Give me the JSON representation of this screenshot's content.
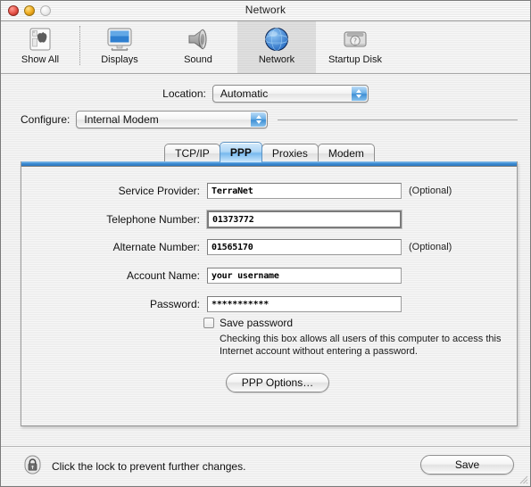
{
  "window": {
    "title": "Network",
    "controls": [
      {
        "name": "close-button",
        "color": "#e8564c"
      },
      {
        "name": "minimize-button",
        "color": "#f0ad20"
      },
      {
        "name": "zoom-button",
        "color": "#ececec"
      }
    ]
  },
  "toolbar": {
    "items": [
      {
        "label": "Show All",
        "icon": "show-all-icon",
        "selected": false
      },
      {
        "label": "Displays",
        "icon": "displays-icon",
        "selected": false
      },
      {
        "label": "Sound",
        "icon": "sound-icon",
        "selected": false
      },
      {
        "label": "Network",
        "icon": "network-icon",
        "selected": true
      },
      {
        "label": "Startup Disk",
        "icon": "startup-disk-icon",
        "selected": false
      }
    ]
  },
  "location": {
    "label": "Location:",
    "value": "Automatic"
  },
  "configure": {
    "label": "Configure:",
    "value": "Internal Modem"
  },
  "tabs": [
    {
      "label": "TCP/IP",
      "active": false
    },
    {
      "label": "PPP",
      "active": true
    },
    {
      "label": "Proxies",
      "active": false
    },
    {
      "label": "Modem",
      "active": false
    }
  ],
  "form": {
    "fields": [
      {
        "label": "Service Provider:",
        "value": "TerraNet",
        "optional": "(Optional)",
        "focused": false
      },
      {
        "label": "Telephone Number:",
        "value": "01373772",
        "optional": "",
        "focused": true
      },
      {
        "label": "Alternate Number:",
        "value": "01565170",
        "optional": "(Optional)",
        "focused": false
      },
      {
        "label": "Account Name:",
        "value": "your username",
        "optional": "",
        "focused": false
      },
      {
        "label": "Password:",
        "value": "***********",
        "optional": "",
        "focused": false
      }
    ],
    "save_password": {
      "label": "Save password",
      "checked": false,
      "help": "Checking this box allows all users of this computer to access this Internet account without entering a password."
    },
    "ppp_options_label": "PPP Options…"
  },
  "bottom": {
    "lock_text": "Click the lock to prevent further changes.",
    "lock_icon": "lock-closed-icon",
    "save_label": "Save"
  },
  "colors": {
    "accent_blue": "#3f8ed4",
    "tab_active": "#77b9ee",
    "window_bg": "#eeeeee"
  }
}
